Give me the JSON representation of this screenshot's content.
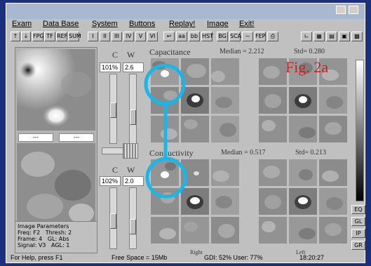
{
  "menu": {
    "items": [
      "Exam",
      "Data Base",
      "System",
      "Buttons",
      "Replay!",
      "Image",
      "Exit!"
    ]
  },
  "toolbar": {
    "roman": [
      "I",
      "II",
      "III",
      "IV",
      "V",
      "VI"
    ],
    "misc": [
      "FPG",
      "TF",
      "REF",
      "SUM",
      "HST",
      "BG",
      "SCA",
      "~",
      "FEP"
    ]
  },
  "top": {
    "c_label": "C",
    "w_label": "W",
    "c_value": "101%",
    "w_value": "2.6",
    "title": "Capacitance",
    "median": "Median = 2.212",
    "std": "Std= 0.280",
    "figure_label": "Fig. 2a"
  },
  "bottom": {
    "c_label": "C",
    "w_label": "W",
    "c_value": "102%",
    "w_value": "2.0",
    "title": "Conductivity",
    "median": "Median = 0.517",
    "std": "Std= 0.213",
    "right_label": "Right",
    "left_label": "Left"
  },
  "left_panel": {
    "field1": "---",
    "field2": "---"
  },
  "params": {
    "title": "Image Parameters",
    "freq": "Freq: F2",
    "thresh": "Thresh: 2",
    "frame": "Frame: 4",
    "gl": "GL: Abs",
    "signal": "Signal: V3",
    "agl": "AGL: 1"
  },
  "side_buttons": [
    "EQ",
    "GL",
    "IP",
    "GR"
  ],
  "status": {
    "help": "For Help, press F1",
    "free": "Free Space = 15Mb",
    "gdi": "GDI: 52% User: 77%",
    "time": "18:20:27"
  },
  "colors": {
    "highlight": "#19b6e8",
    "figure_label": "#cc1f1f",
    "desktop": "#1c2f7a"
  }
}
